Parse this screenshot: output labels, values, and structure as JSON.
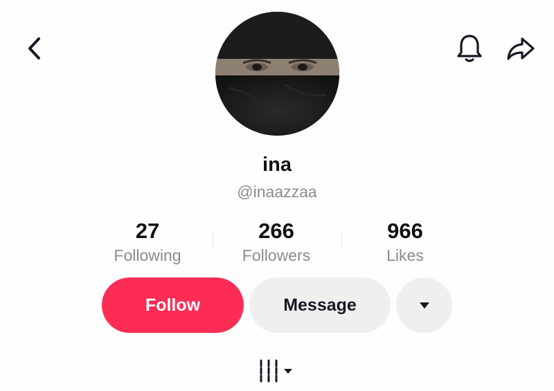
{
  "header": {
    "back_icon": "chevron-left-icon",
    "notification_icon": "bell-icon",
    "share_icon": "share-arrow-icon"
  },
  "profile": {
    "display_name": "ina",
    "username": "@inaazzaa",
    "avatar": "profile-photo"
  },
  "stats": [
    {
      "value": "27",
      "label": "Following"
    },
    {
      "value": "266",
      "label": "Followers"
    },
    {
      "value": "966",
      "label": "Likes"
    }
  ],
  "actions": {
    "follow_label": "Follow",
    "message_label": "Message",
    "more_icon": "caret-down-icon"
  },
  "tabs": {
    "videos_icon": "grid-columns-icon",
    "dropdown_icon": "caret-down-icon"
  },
  "colors": {
    "accent": "#fe2c55",
    "secondary_button": "#efeff0",
    "muted_text": "#8a8b91",
    "text": "#161823"
  }
}
